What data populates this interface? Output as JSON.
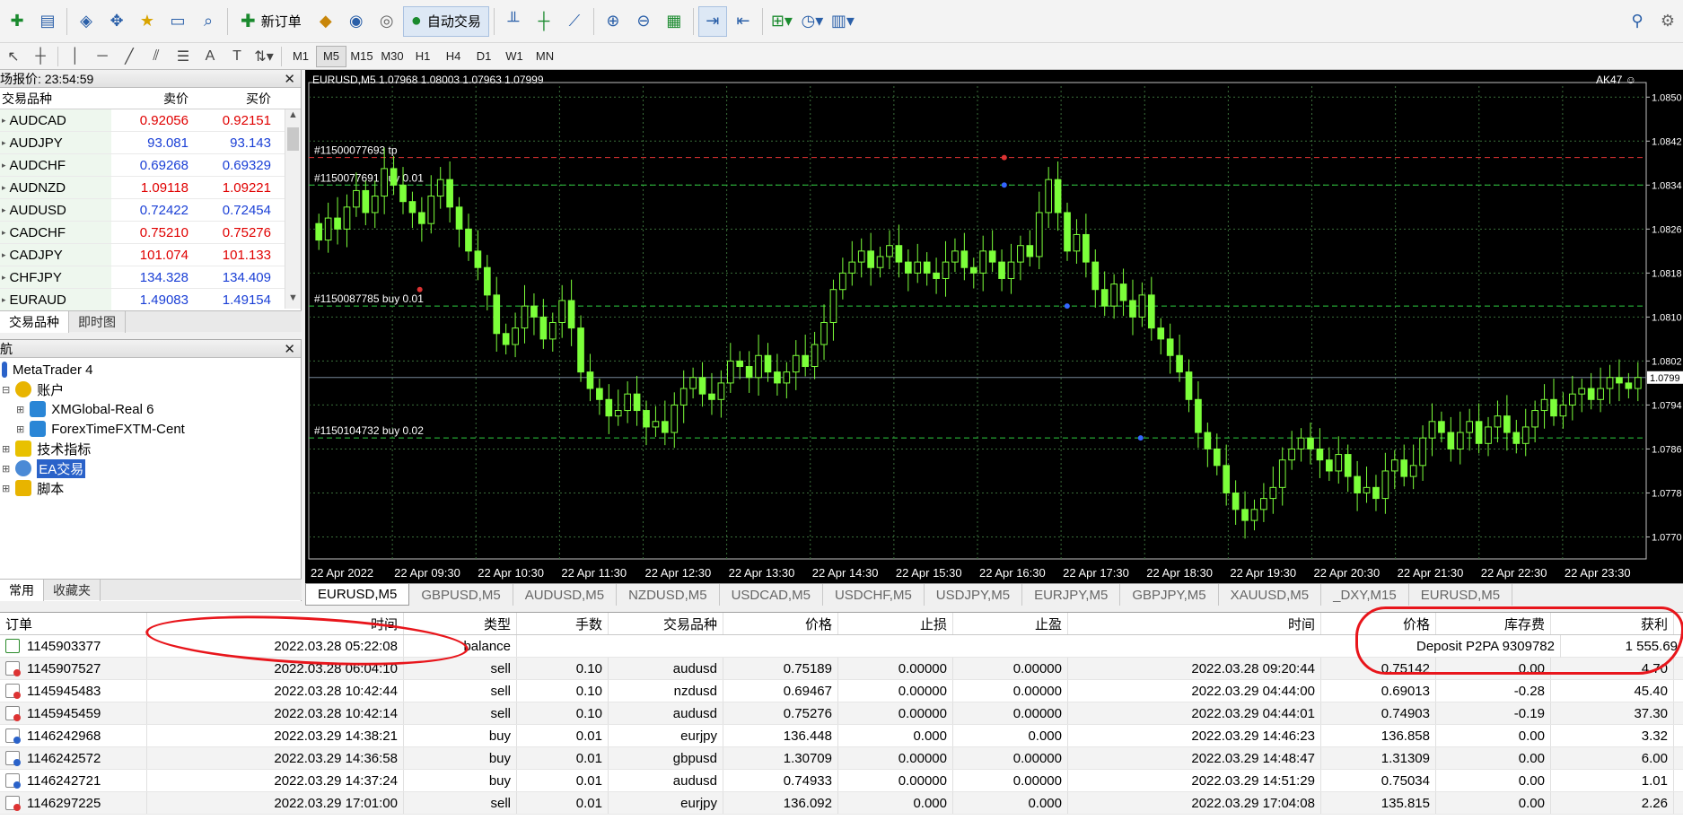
{
  "toolbar": {
    "new_order_label": "新订单",
    "auto_trading_label": "自动交易"
  },
  "timeframes": [
    "M1",
    "M5",
    "M15",
    "M30",
    "H1",
    "H4",
    "D1",
    "W1",
    "MN"
  ],
  "active_timeframe": "M5",
  "market_watch": {
    "title": "场报价: 23:54:59",
    "col_symbol": "交易品种",
    "col_bid": "卖价",
    "col_ask": "买价",
    "rows": [
      {
        "symbol": "AUDCAD",
        "bid": "0.92056",
        "ask": "0.92151",
        "dir": "down"
      },
      {
        "symbol": "AUDJPY",
        "bid": "93.081",
        "ask": "93.143",
        "dir": "up"
      },
      {
        "symbol": "AUDCHF",
        "bid": "0.69268",
        "ask": "0.69329",
        "dir": "up"
      },
      {
        "symbol": "AUDNZD",
        "bid": "1.09118",
        "ask": "1.09221",
        "dir": "down"
      },
      {
        "symbol": "AUDUSD",
        "bid": "0.72422",
        "ask": "0.72454",
        "dir": "up"
      },
      {
        "symbol": "CADCHF",
        "bid": "0.75210",
        "ask": "0.75276",
        "dir": "down"
      },
      {
        "symbol": "CADJPY",
        "bid": "101.074",
        "ask": "101.133",
        "dir": "down"
      },
      {
        "symbol": "CHFJPY",
        "bid": "134.328",
        "ask": "134.409",
        "dir": "up"
      },
      {
        "symbol": "EURAUD",
        "bid": "1.49083",
        "ask": "1.49154",
        "dir": "up"
      }
    ],
    "tabs": [
      "交易品种",
      "即时图"
    ]
  },
  "navigator": {
    "title": "航",
    "root": "MetaTrader 4",
    "accounts_label": "账户",
    "accounts": [
      "XMGlobal-Real 6",
      "ForexTimeFXTM-Cent"
    ],
    "indicators_label": "技术指标",
    "ea_label": "EA交易",
    "scripts_label": "脚本",
    "tabs": [
      "常用",
      "收藏夹"
    ]
  },
  "chart": {
    "header": "EURUSD,M5  1.07968 1.08003 1.07963 1.07999",
    "ea_label": "AK47 ☺",
    "price_labels": [
      "1.0850",
      "1.0842",
      "1.0834",
      "1.0826",
      "1.0818",
      "1.0810",
      "1.0802",
      "1.0799",
      "1.0794",
      "1.0786",
      "1.0778",
      "1.0770"
    ],
    "current_price": "1.0799",
    "time_labels": [
      "22 Apr 2022",
      "22 Apr 09:30",
      "22 Apr 10:30",
      "22 Apr 11:30",
      "22 Apr 12:30",
      "22 Apr 13:30",
      "22 Apr 14:30",
      "22 Apr 15:30",
      "22 Apr 16:30",
      "22 Apr 17:30",
      "22 Apr 18:30",
      "22 Apr 19:30",
      "22 Apr 20:30",
      "22 Apr 21:30",
      "22 Apr 22:30",
      "22 Apr 23:30"
    ],
    "order_labels": [
      {
        "text": "#11500077693 tp",
        "price": 1.0839,
        "color": "#d33"
      },
      {
        "text": "#1150077691 buy 0.01",
        "price": 1.0834
      },
      {
        "text": "#1150087785 buy 0.01",
        "price": 1.0812
      },
      {
        "text": "#1150104732 buy 0.02",
        "price": 1.0788
      }
    ],
    "candles_close": [
      1.0824,
      1.0828,
      1.0826,
      1.083,
      1.0833,
      1.0829,
      1.0832,
      1.0837,
      1.0834,
      1.0831,
      1.0829,
      1.0827,
      1.0832,
      1.0835,
      1.083,
      1.0826,
      1.0822,
      1.0819,
      1.0814,
      1.0807,
      1.0805,
      1.0808,
      1.0812,
      1.081,
      1.0806,
      1.0809,
      1.0813,
      1.0808,
      1.08,
      1.0797,
      1.0795,
      1.0792,
      1.0793,
      1.0796,
      1.0793,
      1.079,
      1.0791,
      1.0789,
      1.0794,
      1.0797,
      1.0799,
      1.0796,
      1.0795,
      1.0798,
      1.0802,
      1.0801,
      1.0799,
      1.0803,
      1.08,
      1.0798,
      1.08,
      1.0803,
      1.0801,
      1.0805,
      1.0809,
      1.0815,
      1.0818,
      1.082,
      1.0822,
      1.0819,
      1.0821,
      1.0823,
      1.082,
      1.0818,
      1.082,
      1.0818,
      1.0817,
      1.082,
      1.0822,
      1.0819,
      1.0818,
      1.0822,
      1.082,
      1.0817,
      1.082,
      1.0823,
      1.0821,
      1.0829,
      1.0835,
      1.0829,
      1.0822,
      1.0825,
      1.082,
      1.0815,
      1.0812,
      1.0816,
      1.0813,
      1.081,
      1.0814,
      1.0808,
      1.0806,
      1.0803,
      1.08,
      1.0795,
      1.0789,
      1.0786,
      1.0783,
      1.0778,
      1.0775,
      1.0773,
      1.0775,
      1.0777,
      1.0779,
      1.0784,
      1.0786,
      1.0788,
      1.0786,
      1.0784,
      1.0782,
      1.0785,
      1.0781,
      1.0778,
      1.0779,
      1.0777,
      1.0782,
      1.0784,
      1.0781,
      1.0783,
      1.0788,
      1.0791,
      1.0789,
      1.0786,
      1.0789,
      1.0791,
      1.0787,
      1.079,
      1.0792,
      1.0789,
      1.0787,
      1.079,
      1.0793,
      1.0795,
      1.0792,
      1.0794,
      1.0796,
      1.0797,
      1.0795,
      1.0797,
      1.0799,
      1.0798,
      1.0797,
      1.0799
    ],
    "candles": 138
  },
  "chart_tabs": [
    "EURUSD,M5",
    "GBPUSD,M5",
    "AUDUSD,M5",
    "NZDUSD,M5",
    "USDCAD,M5",
    "USDCHF,M5",
    "USDJPY,M5",
    "EURJPY,M5",
    "GBPJPY,M5",
    "XAUUSD,M5",
    "_DXY,M15",
    "EURUSD,M5"
  ],
  "terminal": {
    "headers": {
      "order": "订单",
      "time": "时间",
      "type": "类型",
      "lots": "手数",
      "symbol": "交易品种",
      "price": "价格",
      "sl": "止损",
      "tp": "止盈",
      "close_time": "时间",
      "close_price": "价格",
      "swap": "库存费",
      "profit": "获利"
    },
    "balance": {
      "order": "1145903377",
      "time": "2022.03.28 05:22:08",
      "type": "balance",
      "comment": "Deposit P2PA 9309782",
      "profit": "1 555.69"
    },
    "rows": [
      {
        "order": "1145907527",
        "time": "2022.03.28 06:04:10",
        "type": "sell",
        "lots": "0.10",
        "symbol": "audusd",
        "price": "0.75189",
        "sl": "0.00000",
        "tp": "0.00000",
        "close_time": "2022.03.28 09:20:44",
        "close_price": "0.75142",
        "swap": "0.00",
        "profit": "4.70"
      },
      {
        "order": "1145945483",
        "time": "2022.03.28 10:42:44",
        "type": "sell",
        "lots": "0.10",
        "symbol": "nzdusd",
        "price": "0.69467",
        "sl": "0.00000",
        "tp": "0.00000",
        "close_time": "2022.03.29 04:44:00",
        "close_price": "0.69013",
        "swap": "-0.28",
        "profit": "45.40"
      },
      {
        "order": "1145945459",
        "time": "2022.03.28 10:42:14",
        "type": "sell",
        "lots": "0.10",
        "symbol": "audusd",
        "price": "0.75276",
        "sl": "0.00000",
        "tp": "0.00000",
        "close_time": "2022.03.29 04:44:01",
        "close_price": "0.74903",
        "swap": "-0.19",
        "profit": "37.30"
      },
      {
        "order": "1146242968",
        "time": "2022.03.29 14:38:21",
        "type": "buy",
        "lots": "0.01",
        "symbol": "eurjpy",
        "price": "136.448",
        "sl": "0.000",
        "tp": "0.000",
        "close_time": "2022.03.29 14:46:23",
        "close_price": "136.858",
        "swap": "0.00",
        "profit": "3.32"
      },
      {
        "order": "1146242572",
        "time": "2022.03.29 14:36:58",
        "type": "buy",
        "lots": "0.01",
        "symbol": "gbpusd",
        "price": "1.30709",
        "sl": "0.00000",
        "tp": "0.00000",
        "close_time": "2022.03.29 14:48:47",
        "close_price": "1.31309",
        "swap": "0.00",
        "profit": "6.00"
      },
      {
        "order": "1146242721",
        "time": "2022.03.29 14:37:24",
        "type": "buy",
        "lots": "0.01",
        "symbol": "audusd",
        "price": "0.74933",
        "sl": "0.00000",
        "tp": "0.00000",
        "close_time": "2022.03.29 14:51:29",
        "close_price": "0.75034",
        "swap": "0.00",
        "profit": "1.01"
      },
      {
        "order": "1146297225",
        "time": "2022.03.29 17:01:00",
        "type": "sell",
        "lots": "0.01",
        "symbol": "eurjpy",
        "price": "136.092",
        "sl": "0.000",
        "tp": "0.000",
        "close_time": "2022.03.29 17:04:08",
        "close_price": "135.815",
        "swap": "0.00",
        "profit": "2.26"
      }
    ]
  },
  "colors": {
    "up": "#1a3fd6",
    "down": "#e00000",
    "candle": "#7cff3a",
    "grid": "#3a6e3a"
  }
}
